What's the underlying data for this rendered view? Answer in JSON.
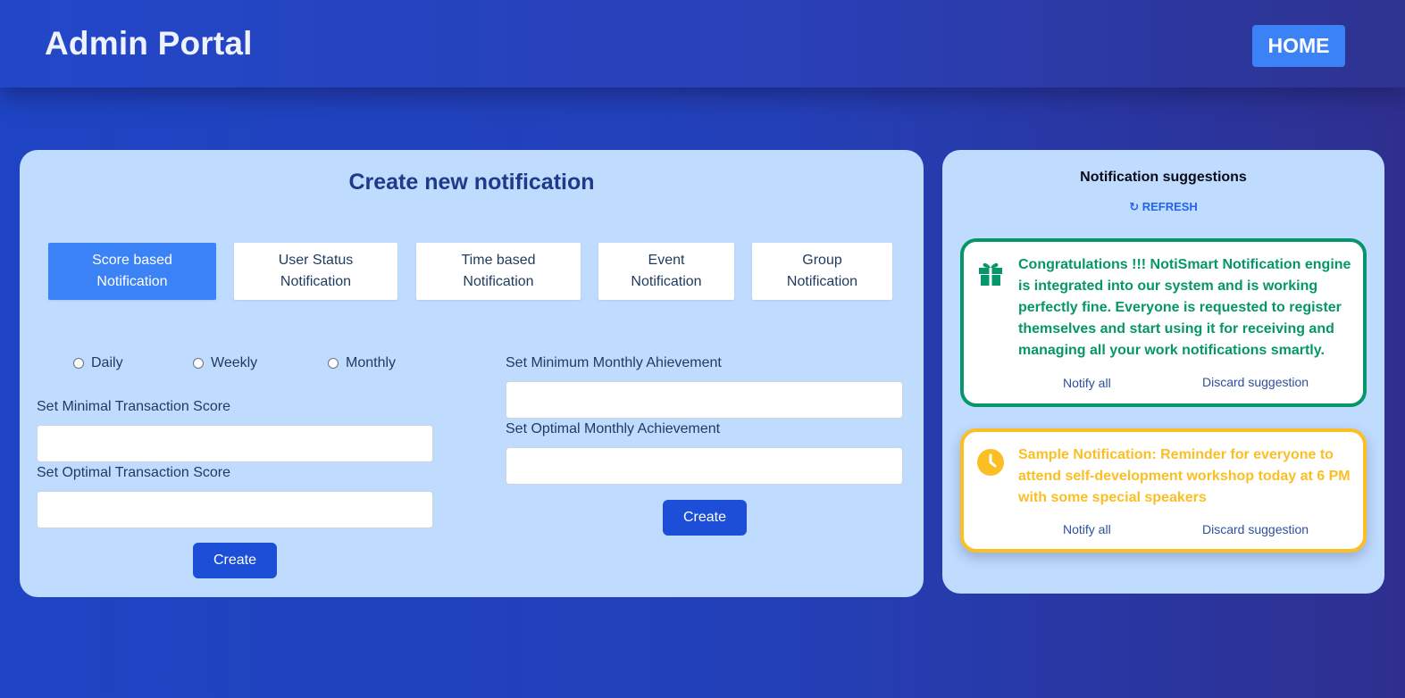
{
  "header": {
    "title": "Admin Portal",
    "home_label": "HOME"
  },
  "create": {
    "title": "Create new notification",
    "tabs": [
      {
        "line1": "Score based",
        "line2": "Notification",
        "active": true
      },
      {
        "line1": "User Status",
        "line2": "Notification",
        "active": false
      },
      {
        "line1": "Time based",
        "line2": "Notification",
        "active": false
      },
      {
        "line1": "Event",
        "line2": "Notification",
        "active": false
      },
      {
        "line1": "Group",
        "line2": "Notification",
        "active": false
      }
    ],
    "frequency": [
      "Daily",
      "Weekly",
      "Monthly"
    ],
    "left_form": {
      "minimal_label": "Set Minimal Transaction Score",
      "minimal_value": "",
      "optimal_label": "Set Optimal Transaction Score",
      "optimal_value": "",
      "button": "Create"
    },
    "right_form": {
      "minimum_label": "Set Minimum Monthly Ahievement",
      "minimum_value": "",
      "optimal_label": "Set Optimal Monthly Achievement",
      "optimal_value": "",
      "button": "Create"
    }
  },
  "suggestions": {
    "title": "Notification suggestions",
    "refresh_label": "↻ REFRESH",
    "items": [
      {
        "icon": "gift-icon",
        "color": "#059669",
        "text": "Congratulations !!! NotiSmart Notification engine is integrated into our system and is working perfectly fine. Everyone is requested to register themselves and start using it for receiving and managing all your work notifications smartly.",
        "notify_label": "Notify all",
        "discard_label": "Discard suggestion"
      },
      {
        "icon": "clock-icon",
        "color": "#fbbf24",
        "text": "Sample Notification: Reminder for everyone to attend self-development workshop today at 6 PM with some special speakers",
        "notify_label": "Notify all",
        "discard_label": "Discard suggestion"
      }
    ]
  }
}
